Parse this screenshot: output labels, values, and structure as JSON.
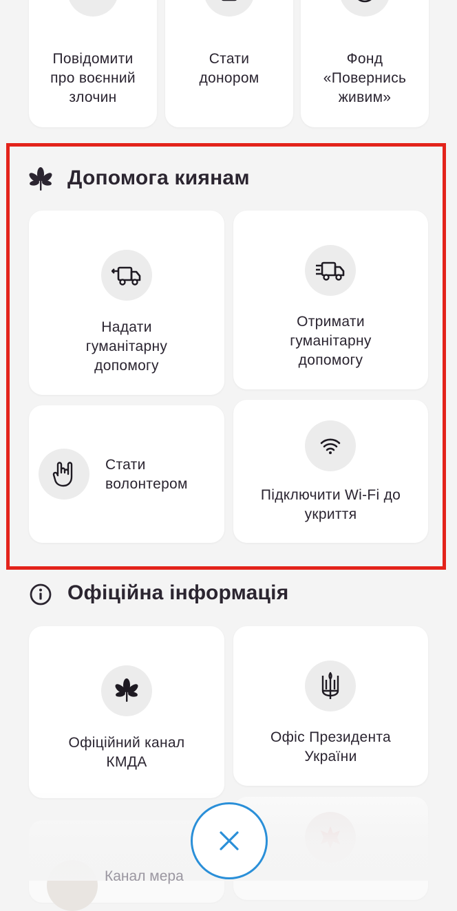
{
  "top_row": [
    {
      "label": "Повідомити\nпро воєнний\nзлочин",
      "icon": "chat-report-icon"
    },
    {
      "label": "Стати\nдонором",
      "icon": "medical-plus-icon"
    },
    {
      "label": "Фонд\n«Повернись\nживим»",
      "icon": "dollar-icon"
    }
  ],
  "help_section": {
    "title": "Допомога киянам",
    "icon": "chestnut-leaf-icon",
    "cards": [
      {
        "label": "Надати\nгуманітарну\nдопомогу",
        "icon": "truck-give-icon"
      },
      {
        "label": "Отримати\nгуманітарну\nдопомогу",
        "icon": "truck-receive-icon"
      },
      {
        "label": "Стати\nволонтером",
        "icon": "hand-gesture-icon"
      },
      {
        "label": "Підключити Wi-Fi до\nукриття",
        "icon": "wifi-icon"
      }
    ]
  },
  "official_section": {
    "title": "Офіційна інформація",
    "icon": "info-icon",
    "cards": [
      {
        "label": "Офіційний канал\nКМДА",
        "icon": "chestnut-leaf-icon"
      },
      {
        "label": "Офіс Президента\nУкраїни",
        "icon": "trident-icon"
      }
    ],
    "peek_label": "Канал мера"
  },
  "close_button": {
    "icon": "close-icon"
  },
  "colors": {
    "highlight": "#e3231b",
    "accent": "#2a8fd8",
    "card": "#ffffff",
    "background": "#f4f4f4"
  }
}
